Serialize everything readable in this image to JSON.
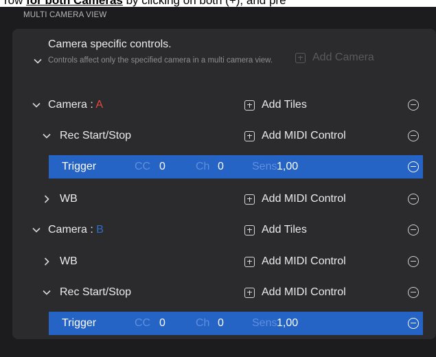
{
  "top_banner": {
    "prefix": "row ",
    "bold": "for both Cameras",
    "suffix": " by clicking on both (+), and pre"
  },
  "section_header": "MULTI CAMERA VIEW",
  "camera_specific": {
    "title": "Camera specific controls.",
    "description": "Controls affect only the specified camera in a multi camera view.",
    "add_camera_label": "Add Camera"
  },
  "rows": {
    "camera_a": {
      "prefix": "Camera : ",
      "letter": "A",
      "add_label": "Add Tiles"
    },
    "camera_a_rec": {
      "label": "Rec Start/Stop",
      "add_label": "Add MIDI Control"
    },
    "camera_a_trigger": {
      "label": "Trigger",
      "cc_label": "CC",
      "cc_value": "0",
      "ch_label": "Ch",
      "ch_value": "0",
      "sens_label": "Sens",
      "sens_value": "1,00"
    },
    "camera_a_wb": {
      "label": "WB",
      "add_label": "Add MIDI Control"
    },
    "camera_b": {
      "prefix": "Camera : ",
      "letter": "B",
      "add_label": "Add Tiles"
    },
    "camera_b_wb": {
      "label": "WB",
      "add_label": "Add MIDI Control"
    },
    "camera_b_rec": {
      "label": "Rec Start/Stop",
      "add_label": "Add MIDI Control"
    },
    "camera_b_trigger": {
      "label": "Trigger",
      "cc_label": "CC",
      "cc_value": "0",
      "ch_label": "Ch",
      "ch_value": "0",
      "sens_label": "Sens",
      "sens_value": "1,00"
    }
  },
  "colors": {
    "background": "#1c1c1e",
    "panel": "#2b2b2d",
    "selection": "#2563c4",
    "camera_a_letter": "#e5483f",
    "camera_b_letter": "#2f6fc7"
  }
}
